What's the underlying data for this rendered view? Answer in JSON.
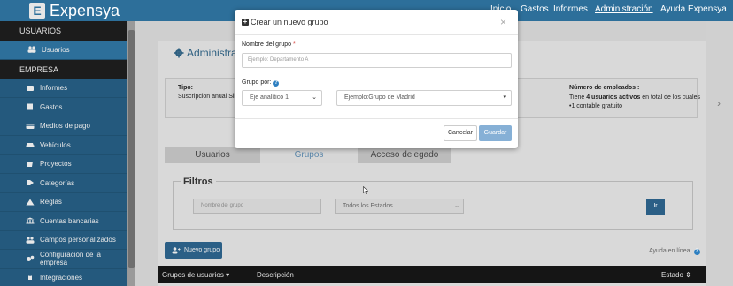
{
  "app": {
    "logo_letter": "E",
    "name": "Expensya"
  },
  "topnav": {
    "items": [
      "Inicio",
      "Gastos",
      "Informes",
      "Administración",
      "Ayuda Expensya"
    ],
    "active": "Administración"
  },
  "sidebar": {
    "section_users": "USUARIOS",
    "users_item": "Usuarios",
    "section_company": "EMPRESA",
    "items": [
      {
        "label": "Informes",
        "icon": "inbox-icon"
      },
      {
        "label": "Gastos",
        "icon": "receipt-icon"
      },
      {
        "label": "Medios de pago",
        "icon": "credit-card-icon"
      },
      {
        "label": "Vehículos",
        "icon": "car-icon"
      },
      {
        "label": "Proyectos",
        "icon": "book-icon"
      },
      {
        "label": "Categorías",
        "icon": "tag-icon"
      },
      {
        "label": "Reglas",
        "icon": "warning-icon"
      },
      {
        "label": "Cuentas bancarias",
        "icon": "bank-icon"
      },
      {
        "label": "Campos personalizados",
        "icon": "users-icon"
      },
      {
        "label": "Configuración de la empresa",
        "icon": "gears-icon"
      },
      {
        "label": "Integraciones",
        "icon": "plug-icon"
      }
    ]
  },
  "page": {
    "title": "Administra",
    "info": {
      "type_label": "Tipo:",
      "type_value": "Suscripcion anual Silve",
      "employees_label": "Número de empleados :",
      "employees_line1_prefix": "Tiene ",
      "employees_line1_bold": "4 usuarios activos",
      "employees_line1_suffix": " en total de los cuales",
      "employees_line2": "•1 contable gratuito"
    },
    "tabs": [
      "Usuarios",
      "Grupos",
      "Acceso delegado"
    ],
    "active_tab": "Grupos",
    "filters": {
      "legend": "Filtros",
      "name_placeholder": "Nombre del grupo",
      "state_select": "Todos los Estados",
      "go_button": "Ir"
    },
    "new_group_button": "Nuevo grupo",
    "help_online": "Ayuda en línea",
    "table_headers": [
      "Grupos de usuarios",
      "Descripción",
      "Estado"
    ]
  },
  "modal": {
    "title": "Crear un nuevo grupo",
    "name_label": "Nombre del grupo",
    "name_placeholder": "Ejemplo: Departamento A",
    "group_by_label": "Grupo por:",
    "axis_select": "Eje analítico 1",
    "example_select": "Ejemplo:Grupo de Madrid",
    "cancel": "Cancelar",
    "save": "Guardar"
  },
  "colors": {
    "brand": "#2d6f9a",
    "sidebar_item": "#24597d",
    "primary_button": "#2b5f86",
    "save_button": "#86b0d6"
  }
}
